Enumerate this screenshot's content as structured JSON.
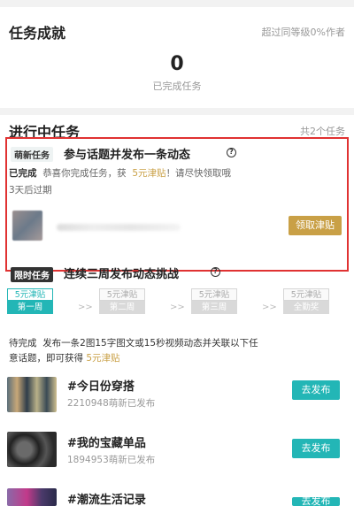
{
  "achievements": {
    "title": "任务成就",
    "rank_note": "超过同等级0%作者",
    "completed_count": "0",
    "completed_label": "已完成任务"
  },
  "ongoing": {
    "title": "进行中任务",
    "total_note": "共2个任务",
    "task1": {
      "tag": "萌新任务",
      "title": "参与话题并发布一条动态",
      "status": "已完成",
      "msg_prefix": "恭喜你完成任务，获",
      "reward": "5元津贴",
      "msg_suffix": "！请尽快领取哦",
      "expire": "3天后过期",
      "claim_label": "领取津贴"
    },
    "task2": {
      "tag": "限时任务",
      "title": "连续三周发布动态挑战",
      "stages": [
        {
          "reward": "5元津贴",
          "name": "第一周",
          "active": true
        },
        {
          "reward": "5元津贴",
          "name": "第二周",
          "active": false
        },
        {
          "reward": "5元津贴",
          "name": "第三周",
          "active": false
        },
        {
          "reward": "5元津贴",
          "name": "全勤奖",
          "active": false
        }
      ],
      "arrow": ">>",
      "status": "待完成",
      "desc_line1": "发布一条2图15字图文或15秒视频动态并关联以下任",
      "desc_line2": "意话题，即可获得",
      "desc_reward": "5元津贴"
    },
    "topics": [
      {
        "title": "#今日份穿搭",
        "count": "2210948萌新已发布",
        "button": "去发布"
      },
      {
        "title": "#我的宝藏单品",
        "count": "1894953萌新已发布",
        "button": "去发布"
      },
      {
        "title": "#潮流生活记录",
        "count": "",
        "button": "去发布"
      }
    ]
  }
}
